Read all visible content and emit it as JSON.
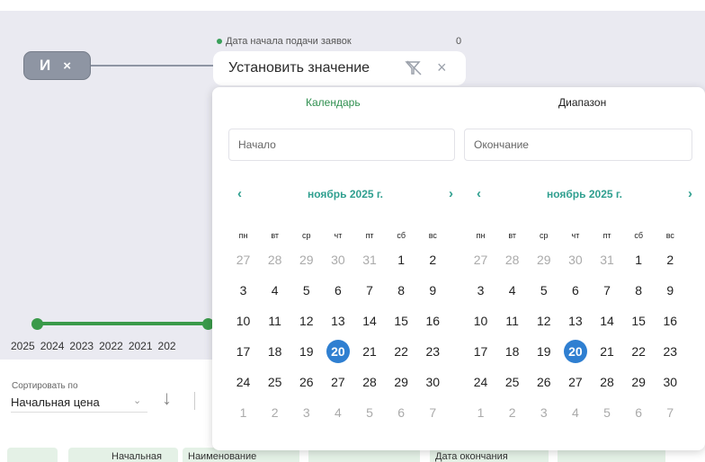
{
  "filter": {
    "and_chip": {
      "label": "И",
      "close": "×"
    },
    "field_label": "Дата начала подачи заявок",
    "field_count": "0",
    "value_pill": {
      "text": "Установить значение",
      "clear": "×"
    }
  },
  "timeline": {
    "years": [
      "2025",
      "2024",
      "2023",
      "2022",
      "2021",
      "202"
    ]
  },
  "sort": {
    "label": "Сортировать по",
    "value": "Начальная цена",
    "chevron": "⌄",
    "direction_icon": "↓"
  },
  "columns": [
    {
      "label": ""
    },
    {
      "label": "Начальная"
    },
    {
      "label": "Наименование"
    },
    {
      "label": ""
    },
    {
      "label": "Дата окончания"
    },
    {
      "label": ""
    }
  ],
  "datepicker": {
    "tabs": {
      "calendar": "Календарь",
      "range": "Диапазон"
    },
    "start_placeholder": "Начало",
    "end_placeholder": "Окончание",
    "prev": "‹",
    "next": "›",
    "weekdays": [
      "пн",
      "вт",
      "ср",
      "чт",
      "пт",
      "сб",
      "вс"
    ],
    "months": [
      {
        "title": "ноябрь 2025 г.",
        "weeks": [
          [
            "27",
            "28",
            "29",
            "30",
            "31",
            "1",
            "2"
          ],
          [
            "3",
            "4",
            "5",
            "6",
            "7",
            "8",
            "9"
          ],
          [
            "10",
            "11",
            "12",
            "13",
            "14",
            "15",
            "16"
          ],
          [
            "17",
            "18",
            "19",
            "20",
            "21",
            "22",
            "23"
          ],
          [
            "24",
            "25",
            "26",
            "27",
            "28",
            "29",
            "30"
          ],
          [
            "1",
            "2",
            "3",
            "4",
            "5",
            "6",
            "7"
          ]
        ],
        "selected": "20"
      },
      {
        "title": "ноябрь 2025 г.",
        "weeks": [
          [
            "27",
            "28",
            "29",
            "30",
            "31",
            "1",
            "2"
          ],
          [
            "3",
            "4",
            "5",
            "6",
            "7",
            "8",
            "9"
          ],
          [
            "10",
            "11",
            "12",
            "13",
            "14",
            "15",
            "16"
          ],
          [
            "17",
            "18",
            "19",
            "20",
            "21",
            "22",
            "23"
          ],
          [
            "24",
            "25",
            "26",
            "27",
            "28",
            "29",
            "30"
          ],
          [
            "1",
            "2",
            "3",
            "4",
            "5",
            "6",
            "7"
          ]
        ],
        "selected": "20"
      }
    ]
  },
  "colors": {
    "accent_green": "#2f8f4f",
    "nav_teal": "#2f9f8f",
    "selected_blue": "#2f7fd1",
    "timeline_green": "#3a9a4a"
  }
}
